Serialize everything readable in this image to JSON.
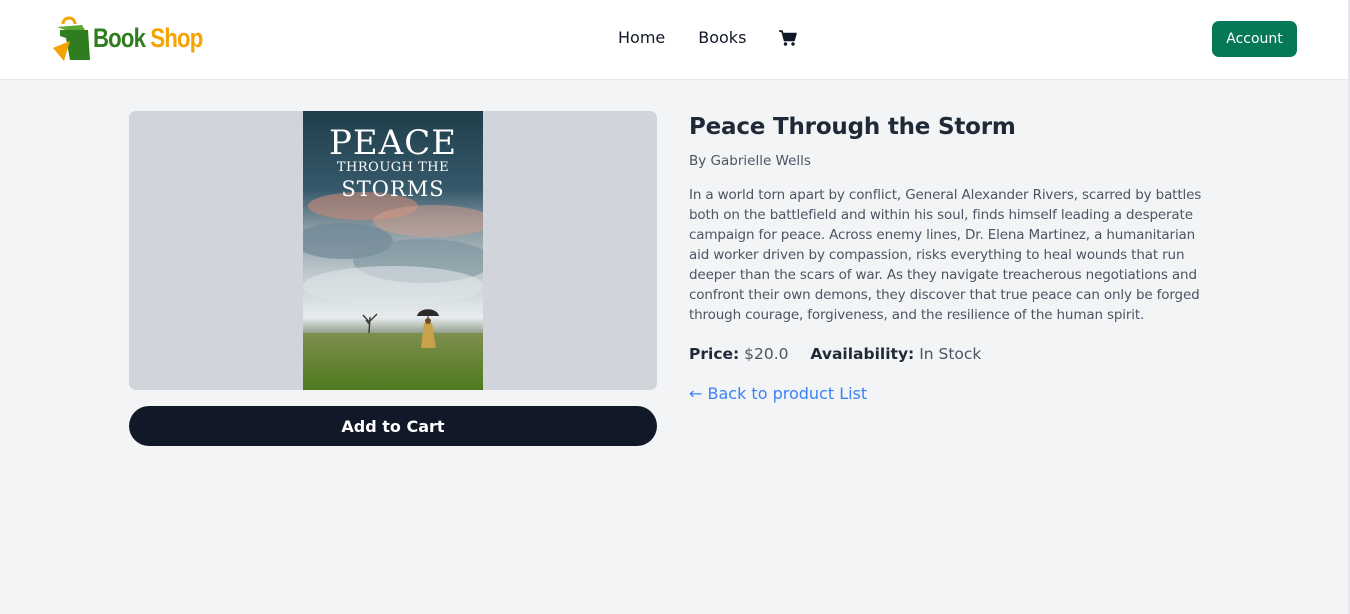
{
  "header": {
    "logo": {
      "part1": "Book",
      "part2": " Shop"
    },
    "nav": [
      {
        "label": "Home"
      },
      {
        "label": "Books"
      }
    ],
    "cart_icon": "shopping-cart-icon",
    "account_label": "Account"
  },
  "product": {
    "cover": {
      "line1": "PEACE",
      "line2": "THROUGH THE",
      "line3": "STORMS"
    },
    "title": "Peace Through the Storm",
    "author": "By Gabrielle Wells",
    "description": "In a world torn apart by conflict, General Alexander Rivers, scarred by battles both on the battlefield and within his soul, finds himself leading a desperate campaign for peace. Across enemy lines, Dr. Elena Martinez, a humanitarian aid worker driven by compassion, risks everything to heal wounds that run deeper than the scars of war. As they navigate treacherous negotiations and confront their own demons, they discover that true peace can only be forged through courage, forgiveness, and the resilience of the human spirit.",
    "price_label": "Price:",
    "price": "$20.0",
    "availability_label": "Availability:",
    "availability": "In Stock",
    "add_to_cart_label": "Add to Cart",
    "back_link": "← Back to product List"
  },
  "colors": {
    "brand_green": "#2f7d1f",
    "brand_orange": "#f5a300",
    "account_button": "#047857",
    "primary_button": "#111827",
    "link": "#3b82f6"
  }
}
